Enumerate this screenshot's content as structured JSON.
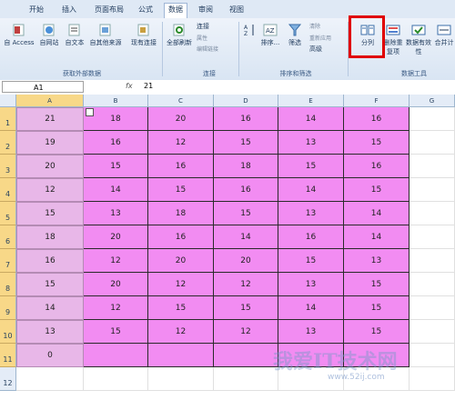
{
  "tabs": [
    {
      "label": "开始"
    },
    {
      "label": "插入"
    },
    {
      "label": "页面布局"
    },
    {
      "label": "公式"
    },
    {
      "label": "数据"
    },
    {
      "label": "审阅"
    },
    {
      "label": "视图"
    }
  ],
  "ribbon": {
    "access": "自 Access",
    "web": "自网站",
    "text": "自文本",
    "other": "自其他来源",
    "existing": "现有连接",
    "refresh": "全部刷新",
    "conn": "连接",
    "props": "属性",
    "editlinks": "编辑链接",
    "sort": "排序...",
    "filter": "筛选",
    "clear": "清除",
    "reapply": "重新应用",
    "advanced": "高级",
    "split": "分列",
    "removedup": "删除重复项",
    "validity": "数据有效性",
    "merge": "合并计",
    "grp_external": "获取外部数据",
    "grp_conn": "连接",
    "grp_sort": "排序和筛选",
    "grp_tools": "数据工具"
  },
  "formula": {
    "cell": "A1",
    "fx": "fx",
    "value": "21"
  },
  "columns": [
    "A",
    "B",
    "C",
    "D",
    "E",
    "F",
    "G"
  ],
  "rows": [
    [
      "21",
      "18",
      "20",
      "16",
      "14",
      "16"
    ],
    [
      "19",
      "16",
      "12",
      "15",
      "13",
      "15"
    ],
    [
      "20",
      "15",
      "16",
      "18",
      "15",
      "16"
    ],
    [
      "12",
      "14",
      "15",
      "16",
      "14",
      "15"
    ],
    [
      "15",
      "13",
      "18",
      "15",
      "13",
      "14"
    ],
    [
      "18",
      "20",
      "16",
      "14",
      "16",
      "14"
    ],
    [
      "16",
      "12",
      "20",
      "20",
      "15",
      "13"
    ],
    [
      "15",
      "20",
      "12",
      "12",
      "13",
      "15"
    ],
    [
      "14",
      "12",
      "15",
      "15",
      "14",
      "15"
    ],
    [
      "13",
      "15",
      "12",
      "12",
      "13",
      "15"
    ],
    [
      "0",
      "",
      "",
      "",
      "",
      ""
    ],
    [
      "",
      "",
      "",
      "",
      "",
      ""
    ]
  ],
  "watermark": {
    "text": "我爱IT技术网",
    "url": "www.52ij.com"
  },
  "colors": {
    "colA": "#e8b7e8",
    "colB_F": "#f28cf2",
    "rowhdr": "#f8d888"
  }
}
